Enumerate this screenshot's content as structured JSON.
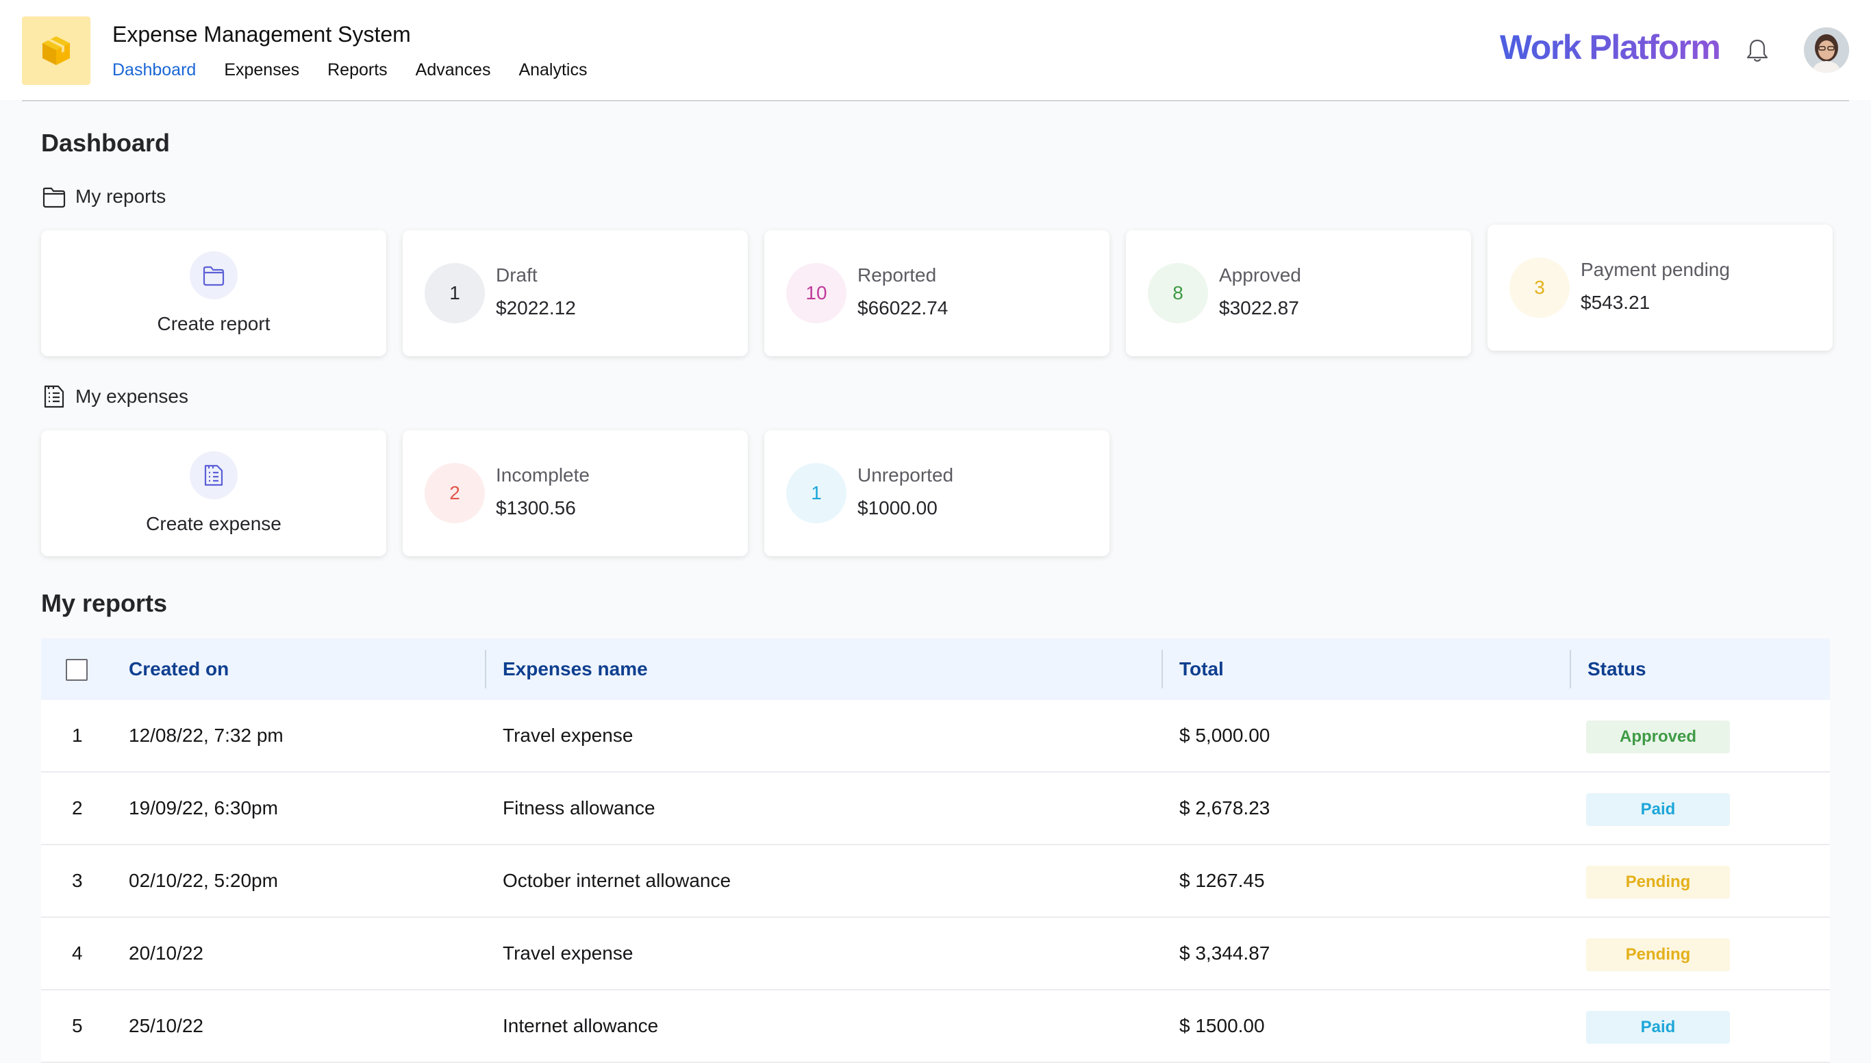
{
  "header": {
    "app_title": "Expense Management System",
    "brand": "Work Platform",
    "nav": [
      {
        "label": "Dashboard",
        "active": true
      },
      {
        "label": "Expenses",
        "active": false
      },
      {
        "label": "Reports",
        "active": false
      },
      {
        "label": "Advances",
        "active": false
      },
      {
        "label": "Analytics",
        "active": false
      }
    ],
    "icons": {
      "logo": "package-icon",
      "bell": "bell-icon",
      "avatar": "user-avatar"
    },
    "colors": {
      "logo_bg": "#fde9a8",
      "nav_active": "#1a66d6",
      "brand_start": "#4c5fe0",
      "brand_end": "#8a56d8"
    }
  },
  "page": {
    "title": "Dashboard"
  },
  "my_reports": {
    "label": "My reports",
    "icon": "folder-icon",
    "create_label": "Create report",
    "stats": [
      {
        "label": "Draft",
        "count": "1",
        "amount": "$2022.12",
        "color": "#2a2a2e",
        "bg": "#eceef2"
      },
      {
        "label": "Reported",
        "count": "10",
        "amount": "$66022.74",
        "color": "#c0399a",
        "bg": "#fbeef6"
      },
      {
        "label": "Approved",
        "count": "8",
        "amount": "$3022.87",
        "color": "#3f9b45",
        "bg": "#eef7ee"
      },
      {
        "label": "Payment pending",
        "count": "3",
        "amount": "$543.21",
        "color": "#e3b11b",
        "bg": "#fdf8e8"
      }
    ]
  },
  "my_expenses": {
    "label": "My expenses",
    "icon": "receipt-icon",
    "create_label": "Create expense",
    "stats": [
      {
        "label": "Incomplete",
        "count": "2",
        "amount": "$1300.56",
        "color": "#e2574c",
        "bg": "#fdeeed"
      },
      {
        "label": "Unreported",
        "count": "1",
        "amount": "$1000.00",
        "color": "#1ea7d8",
        "bg": "#e9f7fc"
      }
    ]
  },
  "reports_table": {
    "heading": "My reports",
    "columns": [
      "Created on",
      "Expenses name",
      "Total",
      "Status"
    ],
    "rows": [
      {
        "num": "1",
        "created": "12/08/22, 7:32 pm",
        "name": "Travel expense",
        "total": "$ 5,000.00",
        "status": "Approved"
      },
      {
        "num": "2",
        "created": "19/09/22, 6:30pm",
        "name": "Fitness allowance",
        "total": "$ 2,678.23",
        "status": "Paid"
      },
      {
        "num": "3",
        "created": "02/10/22, 5:20pm",
        "name": "October internet allowance",
        "total": "$ 1267.45",
        "status": "Pending"
      },
      {
        "num": "4",
        "created": "20/10/22",
        "name": "Travel expense",
        "total": "$ 3,344.87",
        "status": "Pending"
      },
      {
        "num": "5",
        "created": "25/10/22",
        "name": "Internet allowance",
        "total": "$ 1500.00",
        "status": "Paid"
      }
    ],
    "status_colors": {
      "Approved": {
        "fg": "#3f9b45",
        "bg": "#eaf5ea"
      },
      "Paid": {
        "fg": "#1ea7d8",
        "bg": "#e6f5fb"
      },
      "Pending": {
        "fg": "#e3b11b",
        "bg": "#fdf6e1"
      }
    }
  }
}
